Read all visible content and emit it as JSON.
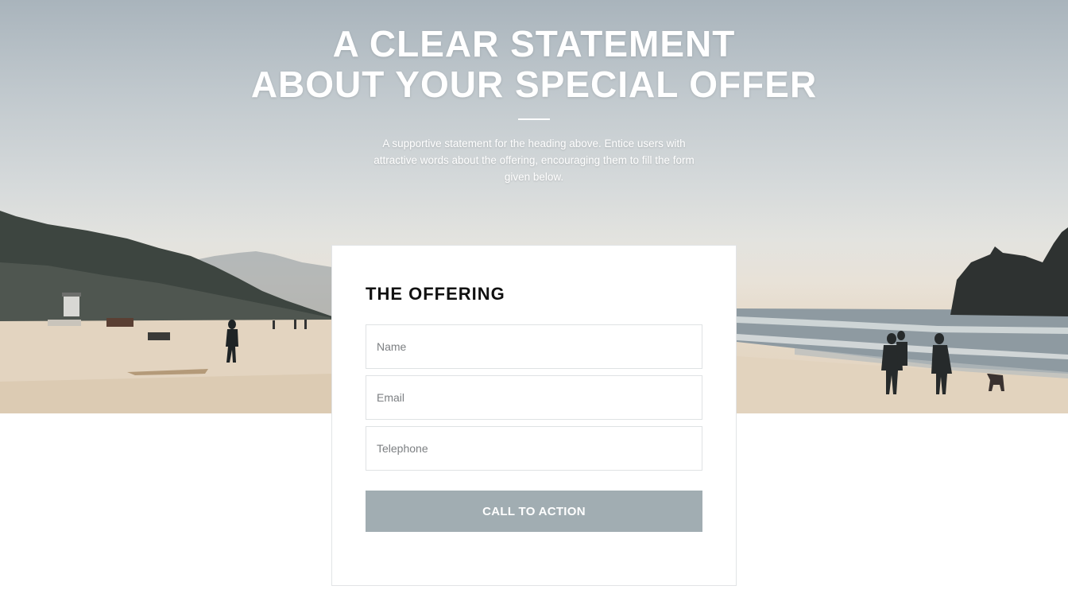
{
  "hero": {
    "headline_line1": "A CLEAR STATEMENT",
    "headline_line2": "ABOUT YOUR SPECIAL OFFER",
    "subtext": "A supportive statement for the heading above. Entice users with attractive words about the offering, encouraging them to fill the form given below."
  },
  "form": {
    "title": "THE OFFERING",
    "name_placeholder": "Name",
    "email_placeholder": "Email",
    "telephone_placeholder": "Telephone",
    "cta_label": "CALL TO ACTION"
  },
  "colors": {
    "cta_background": "#a1adb2",
    "card_border": "#e2e4e6",
    "text_white": "#ffffff"
  }
}
